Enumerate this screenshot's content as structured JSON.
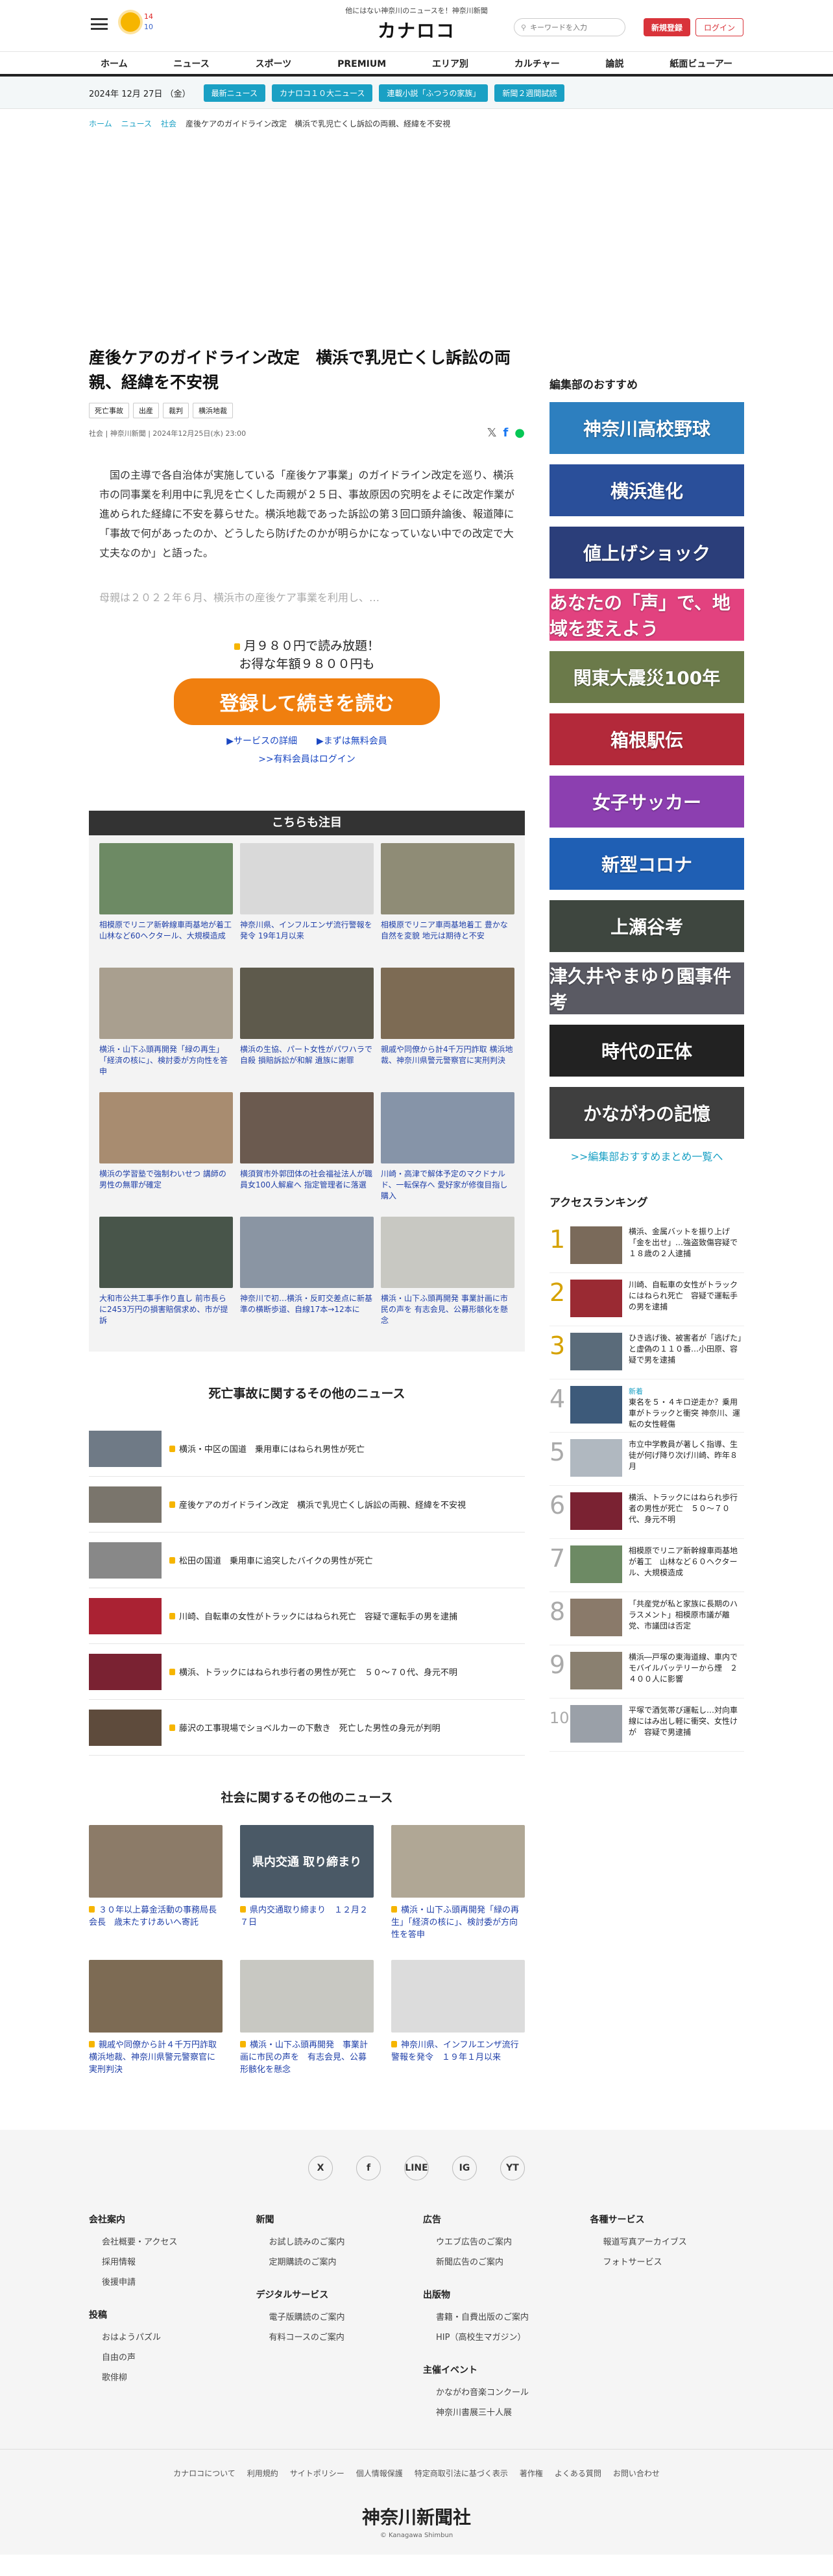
{
  "header": {
    "tagline": "他にはない神奈川のニュースを！神奈川新聞",
    "logo": "カナロコ",
    "weather": {
      "high": "14",
      "low": "10"
    },
    "search_placeholder": "キーワードを入力",
    "register": "新規登録",
    "login": "ログイン"
  },
  "nav": [
    "ホーム",
    "ニュース",
    "スポーツ",
    "PREMIUM",
    "エリア別",
    "カルチャー",
    "論説",
    "紙面ビューアー"
  ],
  "subnav": {
    "date": "2024年 12月 27日 （金）",
    "pills": [
      "最新ニュース",
      "カナロコ１０大ニュース",
      "連載小説「ふつうの家族」",
      "新聞２週間試読"
    ]
  },
  "breadcrumb": [
    "ホーム",
    "ニュース",
    "社会",
    "産後ケアのガイドライン改定　横浜で乳児亡くし訴訟の両親、経緯を不安視"
  ],
  "article": {
    "title": "産後ケアのガイドライン改定　横浜で乳児亡くし訴訟の両親、経緯を不安視",
    "tags": [
      "死亡事故",
      "出産",
      "裁判",
      "横浜地裁"
    ],
    "meta": "社会 | 神奈川新聞 | 2024年12月25日(水) 23:00",
    "lead": "国の主導で各自治体が実施している「産後ケア事業」のガイドライン改定を巡り、横浜市の同事業を利用中に乳児を亡くした両親が２５日、事故原因の究明をよそに改定作業が進められた経緯に不安を募らせた。横浜地裁であった訴訟の第３回口頭弁論後、報道陣に「事故で何があったのか、どうしたら防げたのかが明らかになっていない中での改定で大丈夫なのか」と語った。",
    "faded": "母親は２０２２年６月、横浜市の産後ケア事業を利用し、…"
  },
  "paywall": {
    "line1": "月９８０円で読み放題！",
    "line2": "お得な年額９８００円も",
    "button": "登録して続きを読む",
    "link_service": "▶サービスの詳細",
    "link_free": "▶まずは無料会員",
    "link_login": ">>有料会員はログイン"
  },
  "attention": {
    "title": "こちらも注目",
    "items": [
      {
        "text": "相模原でリニア新幹線車両基地が着工 山林など60ヘクタール、大規模造成",
        "color": "#6d8a64"
      },
      {
        "text": "神奈川県、インフルエンザ流行警報を発令 19年1月以来",
        "color": "#d9d9d9"
      },
      {
        "text": "相模原でリニア車両基地着工 豊かな自然を変貌 地元は期待と不安",
        "color": "#8f8c76"
      },
      {
        "text": "横浜・山下ふ頭再開発「緑の再生」「経済の核に」、検討委が方向性を答申",
        "color": "#a99f8f"
      },
      {
        "text": "横浜の生協、パート女性がパワハラで自殺 損賠訴訟が和解 遺族に謝罪",
        "color": "#5e5a4c"
      },
      {
        "text": "親戚や同僚から計4千万円詐取 横浜地裁、神奈川県警元警察官に実刑判決",
        "color": "#7d6b54"
      },
      {
        "text": "横浜の学習塾で強制わいせつ 講師の男性の無罪が確定",
        "color": "#a88c70"
      },
      {
        "text": "横須賀市外郭団体の社会福祉法人が職員女100人解雇へ 指定管理者に落選",
        "color": "#6b5a4f"
      },
      {
        "text": "川崎・高津で解体予定のマクドナルド、一転保存へ 愛好家が修復目指し購入",
        "color": "#8694a8"
      },
      {
        "text": "大和市公共工事手作り直し 前市長らに2453万円の損害賠償求め、市が提訴",
        "color": "#48554a"
      },
      {
        "text": "神奈川で初…横浜・反町交差点に新基準の横断歩道、自線17本→12本に",
        "color": "#8a95a3"
      },
      {
        "text": "横浜・山下ふ頭再開発 事業計画に市民の声を 有志会見、公募形骸化を懸念",
        "color": "#c8c8c2"
      }
    ]
  },
  "related": {
    "title": "死亡事故に関するその他のニュース",
    "items": [
      {
        "text": "横浜・中区の国道　乗用車にはねられ男性が死亡",
        "color": "#6f7a86"
      },
      {
        "text": "産後ケアのガイドライン改定　横浜で乳児亡くし訴訟の両親、経緯を不安視",
        "color": "#7a756c"
      },
      {
        "text": "松田の国道　乗用車に追突したバイクの男性が死亡",
        "color": "#888"
      },
      {
        "text": "川崎、自転車の女性がトラックにはねられ死亡　容疑で運転手の男を逮捕",
        "color": "#a23"
      },
      {
        "text": "横浜、トラックにはねられ歩行者の男性が死亡　５０～７０代、身元不明",
        "color": "#7a2232"
      },
      {
        "text": "藤沢の工事現場でショベルカーの下敷き　死亡した男性の身元が判明",
        "color": "#5e4b3c"
      }
    ]
  },
  "society": {
    "title": "社会に関するその他のニュース",
    "items": [
      {
        "text": "３０年以上募金活動の事務局長会長　歳末たすけあいへ寄託",
        "color": "#8c7b68"
      },
      {
        "text": "県内交通取り締まり　１２月２７日",
        "color": "#4a5966",
        "overlay": "県内交通 取り締まり"
      },
      {
        "text": "横浜・山下ふ頭再開発「緑の再生」「経済の核に」、検討委が方向性を答申",
        "color": "#b0a795"
      },
      {
        "text": "親戚や同僚から計４千万円詐取　横浜地裁、神奈川県警元警察官に実刑判決",
        "color": "#7d6b54"
      },
      {
        "text": "横浜・山下ふ頭再開発　事業計画に市民の声を　有志会見、公募形骸化を懸念",
        "color": "#c8c8c2"
      },
      {
        "text": "神奈川県、インフルエンザ流行警報を発令　１９年１月以来",
        "color": "#dcdcdc"
      }
    ]
  },
  "sidebar": {
    "editor_title": "編集部のおすすめ",
    "banners": [
      {
        "label": "神奈川高校野球",
        "color": "#2d7fbf"
      },
      {
        "label": "横浜進化",
        "color": "#2a4f9a"
      },
      {
        "label": "値上げショック",
        "color": "#2b3e7a"
      },
      {
        "label": "あなたの「声」で、地域を変えよう",
        "color": "#e2427f"
      },
      {
        "label": "関東大震災100年",
        "color": "#6b7a4a"
      },
      {
        "label": "箱根駅伝",
        "color": "#b3293a"
      },
      {
        "label": "女子サッカー",
        "color": "#8c3fb0"
      },
      {
        "label": "新型コロナ",
        "color": "#1f5fb4"
      },
      {
        "label": "上瀬谷考",
        "color": "#3e463f"
      },
      {
        "label": "津久井やまゆり園事件考",
        "color": "#5a5a63"
      },
      {
        "label": "時代の正体",
        "color": "#222"
      },
      {
        "label": "かながわの記憶",
        "color": "#3f3f3f"
      }
    ],
    "more": ">>編集部おすすめまとめ一覧へ",
    "ranking_title": "アクセスランキング",
    "ranking": [
      {
        "n": "1",
        "text": "横浜、金属バットを振り上げ「金を出せ」…強盗致傷容疑で１８歳の２人逮捕",
        "new": "",
        "color": "#7a6a5a"
      },
      {
        "n": "2",
        "text": "川崎、自転車の女性がトラックにはねられ死亡　容疑で運転手の男を逮捕",
        "new": "",
        "color": "#9a2a33"
      },
      {
        "n": "3",
        "text": "ひき逃げ後、被害者が「逃げた」と虚偽の１１０番…小田原、容疑で男を逮捕",
        "new": "",
        "color": "#5a6b7a"
      },
      {
        "n": "4",
        "text": "東名を５・４キロ逆走か？乗用車がトラックと衝突 神奈川、運転の女性軽傷",
        "new": "新着",
        "color": "#3d5a7a"
      },
      {
        "n": "5",
        "text": "市立中学教員が著しく指導、生徒が何げ降り次げ川崎、昨年８月",
        "new": "",
        "color": "#b0b8c0"
      },
      {
        "n": "6",
        "text": "横浜、トラックにはねられ歩行者の男性が死亡　５０～７０代、身元不明",
        "new": "",
        "color": "#7a2232"
      },
      {
        "n": "7",
        "text": "相模原でリニア新幹線車両基地が着工　山林など６０ヘクタール、大規模造成",
        "new": "",
        "color": "#6d8a64"
      },
      {
        "n": "8",
        "text": "「共産党が私と家族に長期のハラスメント」相模原市議が離党、市議団は否定",
        "new": "",
        "color": "#8a7a6a"
      },
      {
        "n": "9",
        "text": "横浜―戸塚の東海道線、車内でモバイルバッテリーから煙　２４００人に影響",
        "new": "",
        "color": "#8a8070"
      },
      {
        "n": "10",
        "text": "平塚で酒気帯び運転し…対向車線にはみ出し軽に衝突、女性けが　容疑で男逮捕",
        "new": "",
        "color": "#9aa0a8"
      }
    ]
  },
  "footer": {
    "sns": [
      "X",
      "f",
      "LINE",
      "IG",
      "YT"
    ],
    "cols": [
      {
        "groups": [
          {
            "h": "会社案内",
            "items": [
              "会社概要・アクセス",
              "採用情報",
              "後援申請"
            ]
          },
          {
            "h": "投稿",
            "items": [
              "おはようパズル",
              "自由の声",
              "歌俳柳"
            ]
          }
        ]
      },
      {
        "groups": [
          {
            "h": "新聞",
            "items": [
              "お試し読みのご案内",
              "定期購読のご案内"
            ]
          },
          {
            "h": "デジタルサービス",
            "items": [
              "電子版購読のご案内",
              "有料コースのご案内"
            ]
          }
        ]
      },
      {
        "groups": [
          {
            "h": "広告",
            "items": [
              "ウエブ広告のご案内",
              "新聞広告のご案内"
            ]
          },
          {
            "h": "出版物",
            "items": [
              "書籍・自費出版のご案内",
              "HIP（高校生マガジン）"
            ]
          },
          {
            "h": "主催イベント",
            "items": [
              "かながわ音楽コンクール",
              "神奈川書展三十人展"
            ]
          }
        ]
      },
      {
        "groups": [
          {
            "h": "各種サービス",
            "items": [
              "報道写真アーカイブス",
              "フォトサービス"
            ]
          }
        ]
      }
    ],
    "links": [
      "カナロコについて",
      "利用規約",
      "サイトポリシー",
      "個人情報保護",
      "特定商取引法に基づく表示",
      "著作権",
      "よくある質問",
      "お問い合わせ"
    ],
    "brand": "神奈川新聞社",
    "copyright": "© Kanagawa Shimbun"
  }
}
